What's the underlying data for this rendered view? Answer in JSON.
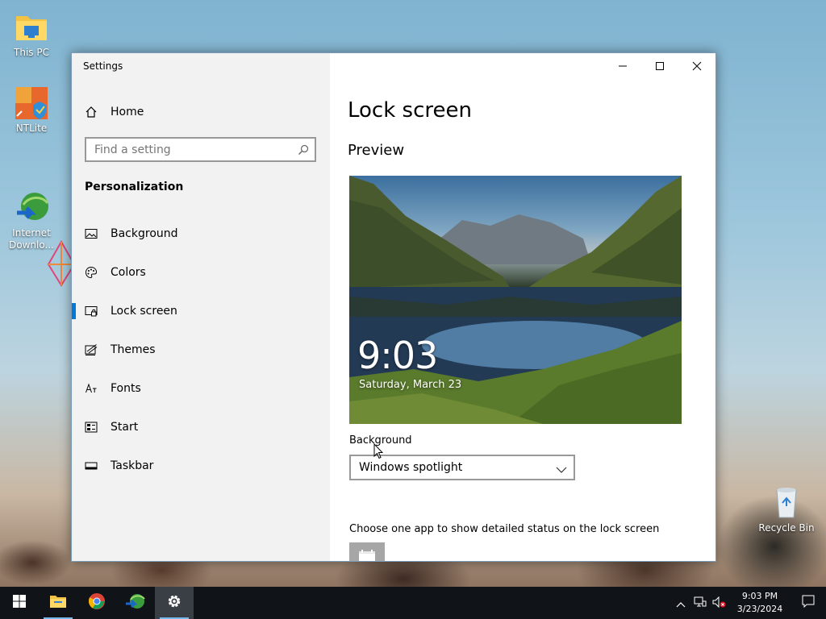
{
  "desktop": {
    "icons": [
      {
        "label": "This PC"
      },
      {
        "label": "NTLite"
      },
      {
        "label": "Internet\nDownlo..."
      },
      {
        "label": "Recycle Bin"
      }
    ]
  },
  "window": {
    "title": "Settings",
    "home_label": "Home",
    "search_placeholder": "Find a setting",
    "section_title": "Personalization",
    "nav_items": [
      {
        "label": "Background",
        "icon": "image-icon"
      },
      {
        "label": "Colors",
        "icon": "palette-icon"
      },
      {
        "label": "Lock screen",
        "icon": "lock-screen-icon",
        "active": true
      },
      {
        "label": "Themes",
        "icon": "themes-icon"
      },
      {
        "label": "Fonts",
        "icon": "fonts-icon"
      },
      {
        "label": "Start",
        "icon": "start-icon"
      },
      {
        "label": "Taskbar",
        "icon": "taskbar-icon"
      }
    ]
  },
  "content": {
    "page_title": "Lock screen",
    "preview_title": "Preview",
    "preview_time": "9:03",
    "preview_date": "Saturday, March 23",
    "background_label": "Background",
    "background_value": "Windows spotlight",
    "status_label": "Choose one app to show detailed status on the lock screen"
  },
  "taskbar": {
    "time": "9:03 PM",
    "date": "3/23/2024"
  },
  "colors": {
    "accent": "#0078d7",
    "taskbar": "#101418"
  }
}
